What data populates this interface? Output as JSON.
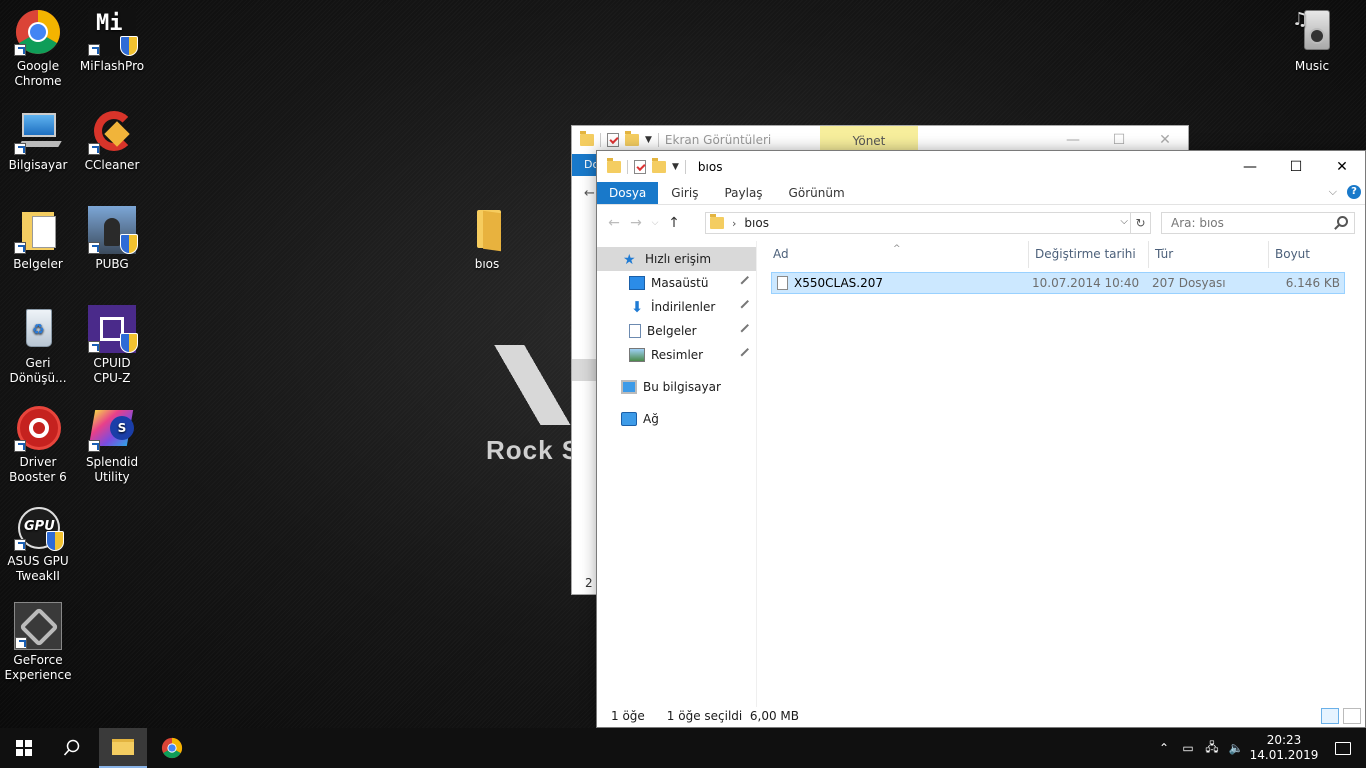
{
  "desktop": {
    "icons": [
      {
        "label": "Google\nChrome",
        "icon": "chrome-icon"
      },
      {
        "label": "MiFlashPro",
        "icon": "mi-icon"
      },
      {
        "label": "Bilgisayar",
        "icon": "computer-icon"
      },
      {
        "label": "CCleaner",
        "icon": "ccleaner-icon"
      },
      {
        "label": "Belgeler",
        "icon": "documents-icon"
      },
      {
        "label": "PUBG",
        "icon": "pubg-icon"
      },
      {
        "label": "Geri\nDönüşü...",
        "icon": "recycle-bin-icon"
      },
      {
        "label": "CPUID\nCPU-Z",
        "icon": "cpuz-icon"
      },
      {
        "label": "Driver\nBooster 6",
        "icon": "driver-booster-icon"
      },
      {
        "label": "Splendid\nUtility",
        "icon": "splendid-icon"
      },
      {
        "label": "ASUS GPU\nTweakII",
        "icon": "gpu-tweak-icon"
      },
      {
        "label": "GeForce\nExperience",
        "icon": "geforce-icon"
      },
      {
        "label": "bıos",
        "icon": "folder-icon"
      },
      {
        "label": "Music",
        "icon": "music-icon"
      }
    ],
    "wallpaper_text": "Rock S"
  },
  "bg_window": {
    "title": "Ekran Görüntüleri",
    "manage_tab": "Yönet",
    "ribbon_partial": "Do",
    "status_partial": "2 ö"
  },
  "explorer": {
    "title": "bıos",
    "ribbon_tabs": [
      "Dosya",
      "Giriş",
      "Paylaş",
      "Görünüm"
    ],
    "address": "bıos",
    "search_placeholder": "Ara: bıos",
    "nav_pane": [
      {
        "label": "Hızlı erişim",
        "icon": "star-icon",
        "selected": true,
        "pinned": false
      },
      {
        "label": "Masaüstü",
        "icon": "desktop-icon",
        "pinned": true
      },
      {
        "label": "İndirilenler",
        "icon": "download-icon",
        "pinned": true
      },
      {
        "label": "Belgeler",
        "icon": "documents-icon",
        "pinned": true
      },
      {
        "label": "Resimler",
        "icon": "pictures-icon",
        "pinned": true
      },
      {
        "label": "Bu bilgisayar",
        "icon": "computer-icon"
      },
      {
        "label": "Ağ",
        "icon": "network-icon"
      }
    ],
    "columns": [
      "Ad",
      "Değiştirme tarihi",
      "Tür",
      "Boyut"
    ],
    "files": [
      {
        "name": "X550CLAS.207",
        "modified": "10.07.2014 10:40",
        "type": "207 Dosyası",
        "size": "6.146 KB"
      }
    ],
    "status": {
      "count": "1 öğe",
      "selection": "1 öğe seçildi  6,00 MB"
    }
  },
  "taskbar": {
    "time": "20:23",
    "date": "14.01.2019"
  },
  "colors": {
    "accent": "#1979ca",
    "selection": "#cce8ff"
  }
}
